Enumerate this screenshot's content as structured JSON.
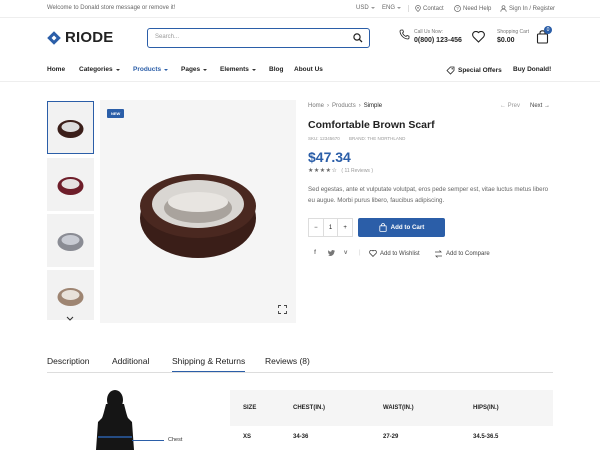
{
  "topbar": {
    "welcome": "Welcome to Donald store message or remove it!",
    "currency": "USD",
    "language": "ENG",
    "contact": "Contact",
    "help": "Need Help",
    "signin": "Sign In / Register"
  },
  "header": {
    "logo": "RIODE",
    "search_placeholder": "Search...",
    "call_label": "Call Us Now:",
    "call_number": "0(800) 123-456",
    "cart_label": "Shopping Cart",
    "cart_total": "$0.00",
    "cart_count": "0"
  },
  "nav": {
    "items": [
      "Home",
      "Categories",
      "Products",
      "Pages",
      "Elements",
      "Blog",
      "About Us"
    ],
    "special": "Special Offers",
    "buy": "Buy Donald!"
  },
  "gallery": {
    "badge": "NEW"
  },
  "product": {
    "breadcrumb": [
      "Home",
      "Products",
      "Simple"
    ],
    "prev": "Prev",
    "next": "Next",
    "title": "Comfortable Brown Scarf",
    "sku": "SKU: 12345670",
    "brand": "BRAND: THE NORTHLAND",
    "price": "$47.34",
    "rating": 4,
    "reviews": "( 11 Reviews )",
    "description": "Sed egestas, ante et vulputate volutpat, eros pede semper est, vitae luctus metus libero eu augue. Morbi purus libero, faucibus adipiscing.",
    "qty": "1",
    "add_to_cart": "Add to Cart",
    "wishlist": "Add to Wishlist",
    "compare": "Add to Compare"
  },
  "tabs": [
    "Description",
    "Additional",
    "Shipping & Returns",
    "Reviews (8)"
  ],
  "size_table": {
    "headers": [
      "SIZE",
      "CHEST(IN.)",
      "WAIST(IN.)",
      "HIPS(IN.)"
    ],
    "row": [
      "XS",
      "34-36",
      "27-29",
      "34.5-36.5"
    ],
    "chest_label": "Chest"
  },
  "colors": {
    "accent": "#2b5ea8"
  }
}
